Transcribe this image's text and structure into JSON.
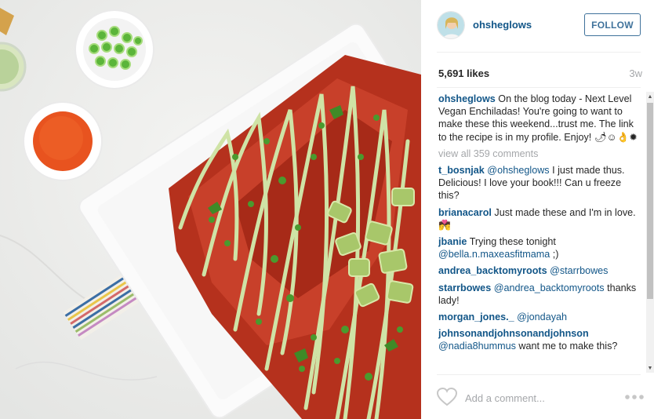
{
  "post": {
    "username": "ohsheglows",
    "follow_label": "FOLLOW",
    "likes": "5,691 likes",
    "time_ago": "3w"
  },
  "caption": {
    "user": "ohsheglows",
    "text": "On the blog today - Next Level Vegan Enchiladas! You're going to want to make these this weekend...trust me. The link to the recipe is in my profile. Enjoy! 🌶☺👌✹"
  },
  "view_all": "view all 359 comments",
  "comments": [
    {
      "user": "t_bosnjak",
      "mention": "@ohsheglows",
      "text": "I just made thus. Delicious! I love your book!!! Can u freeze this?"
    },
    {
      "user": "brianacarol",
      "mention": "",
      "text": "Just made these and I'm in love. 💏"
    },
    {
      "user": "jbanie",
      "text": "Trying these tonight",
      "mention_after": "@bella.n.maxeasfitmama",
      "text_after": ";)"
    },
    {
      "user": "andrea_backtomyroots",
      "mention": "@starrbowes",
      "text": ""
    },
    {
      "user": "starrbowes",
      "mention": "@andrea_backtomyroots",
      "text": "thanks lady!"
    },
    {
      "user": "morgan_jones._",
      "mention": "@jondayah",
      "text": ""
    },
    {
      "user": "johnsonandjohnsonandjohnson",
      "mention": "@nadia8hummus",
      "text": "want me to make this?"
    }
  ],
  "add_comment_placeholder": "Add a comment...",
  "icons": {
    "like": "heart-outline-icon",
    "more": "more-dots-icon",
    "scroll_up": "chevron-up-icon",
    "scroll_down": "chevron-down-icon"
  },
  "colors": {
    "link_blue": "#125688",
    "follow_blue": "#3f729b",
    "muted_gray": "#a5a7aa"
  }
}
